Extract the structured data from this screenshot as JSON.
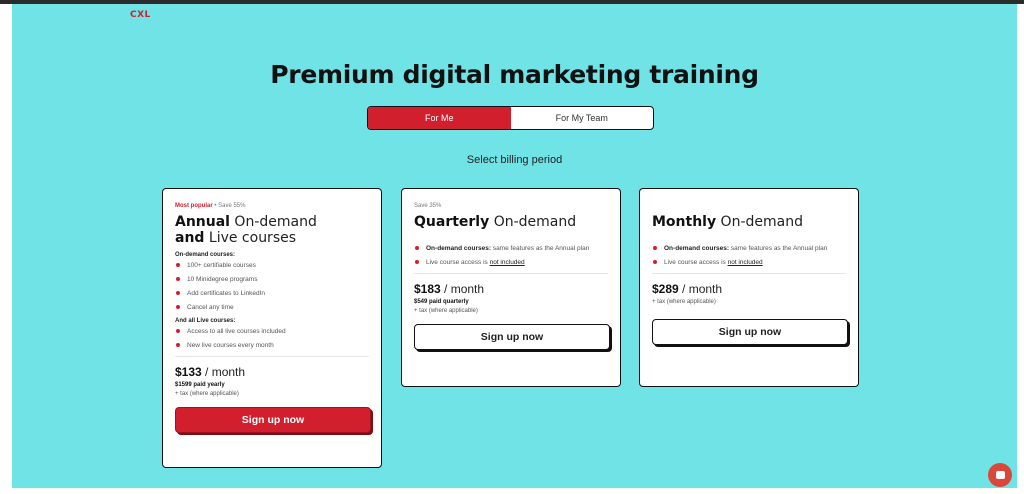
{
  "brand": {
    "logo": "CXL"
  },
  "hero": {
    "title": "Premium digital marketing training"
  },
  "toggle": {
    "options": [
      "For Me",
      "For My Team"
    ],
    "selected": "For Me"
  },
  "billing_label": "Select billing period",
  "plans": [
    {
      "tag_popular": "Most popular",
      "tag_sep": " • ",
      "tag_save": "Save 55%",
      "name_bold_1": "Annual",
      "name_rest_1": " On-demand",
      "name_bold_2": "and",
      "name_rest_2": " Live courses",
      "section1": "On-demand courses:",
      "features1": [
        "100+ certifiable courses",
        "10 Minidegree programs",
        "Add certificates to LinkedIn",
        "Cancel any time"
      ],
      "section2": "And all Live courses:",
      "features2": [
        "Access to all live courses included",
        "New live courses every month"
      ],
      "price": "$133",
      "per": " / month",
      "paid": "$1599 paid yearly",
      "tax": "+ tax (where applicable)",
      "cta": "Sign up now"
    },
    {
      "tag_save": "Save 35%",
      "name_bold": "Quarterly",
      "name_rest": " On-demand",
      "feature1_bold": "On-demand courses:",
      "feature1_rest": " same features as the Annual plan",
      "feature2_text": "Live course access is ",
      "feature2_link": "not included",
      "price": "$183",
      "per": " / month",
      "paid": "$549 paid quarterly",
      "tax": "+ tax (where applicable)",
      "cta": "Sign up now"
    },
    {
      "name_bold": "Monthly",
      "name_rest": " On-demand",
      "feature1_bold": "On-demand courses:",
      "feature1_rest": " same features as the Annual plan",
      "feature2_text": "Live course access is ",
      "feature2_link": "not included",
      "price": "$289",
      "per": " / month",
      "tax": "+ tax (where applicable)",
      "cta": "Sign up now"
    }
  ],
  "colors": {
    "background": "#6fe3e6",
    "accent": "#d21f2e",
    "text": "#111111"
  },
  "icons": {
    "chat": "chat-bubble-icon",
    "bullet": "red-dot-icon"
  }
}
